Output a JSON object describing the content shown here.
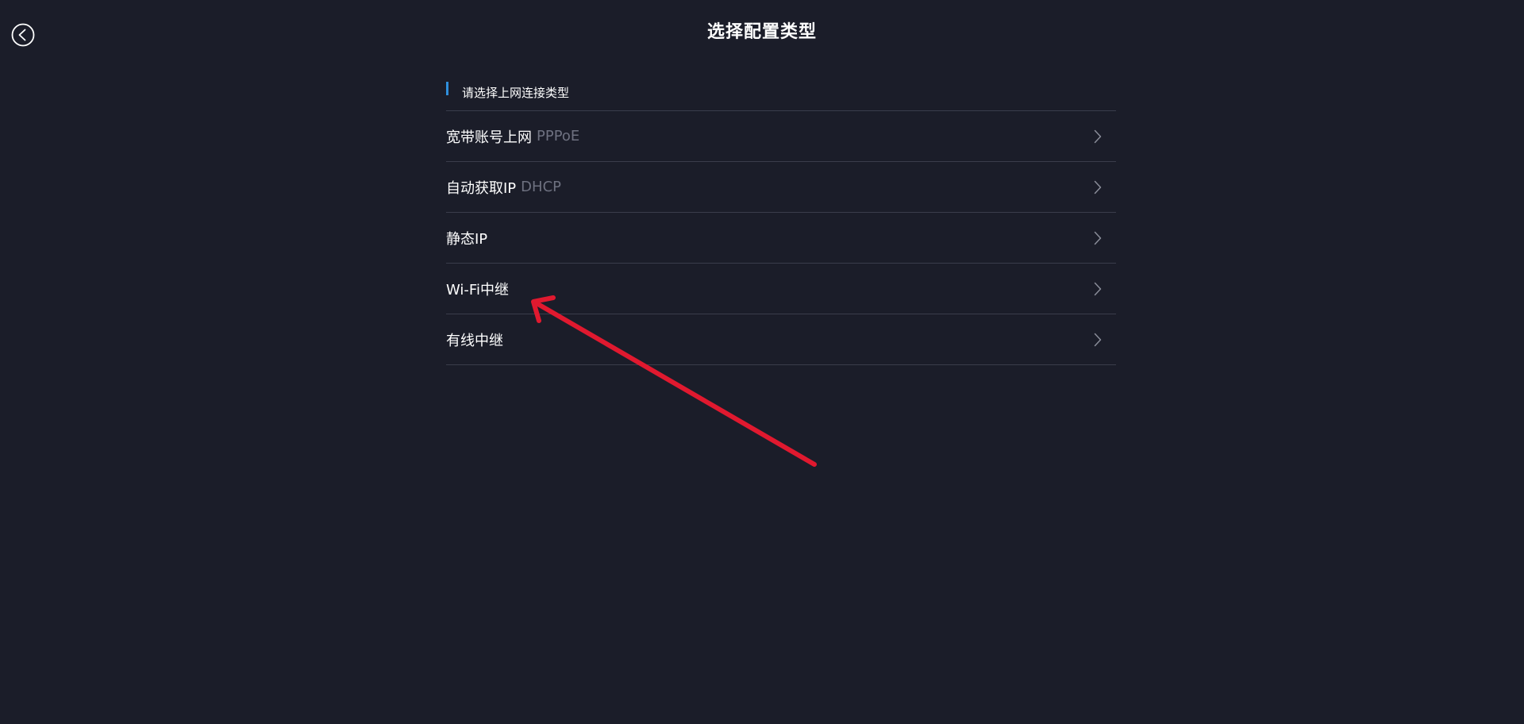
{
  "header": {
    "title": "选择配置类型",
    "back_icon": "back-arrow-circle-icon"
  },
  "section": {
    "label": "请选择上网连接类型",
    "accent_color": "#2f8fdc"
  },
  "options": [
    {
      "label": "宽带账号上网",
      "sub": "PPPoE",
      "icon": "chevron-right-icon"
    },
    {
      "label": "自动获取IP",
      "sub": "DHCP",
      "icon": "chevron-right-icon"
    },
    {
      "label": "静态IP",
      "sub": "",
      "icon": "chevron-right-icon"
    },
    {
      "label": "Wi-Fi中继",
      "sub": "",
      "icon": "chevron-right-icon"
    },
    {
      "label": "有线中继",
      "sub": "",
      "icon": "chevron-right-icon"
    }
  ],
  "annotation": {
    "icon": "red-arrow-annotation",
    "color": "#e0192f"
  },
  "colors": {
    "background": "#1b1d29",
    "divider": "#3a3d4b",
    "muted_text": "#6e7180"
  }
}
